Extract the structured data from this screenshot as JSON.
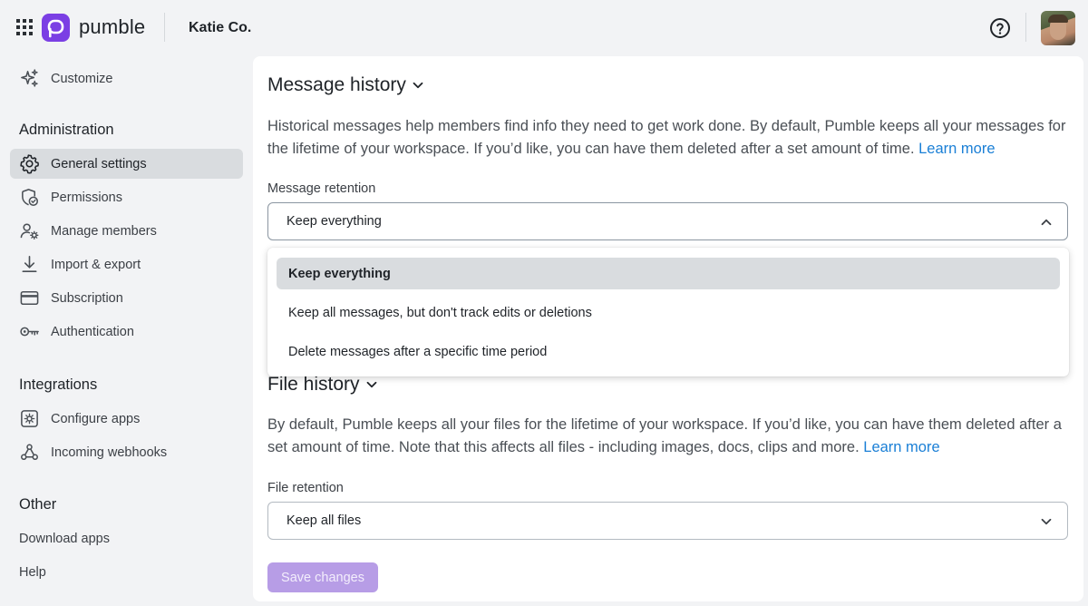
{
  "header": {
    "brand": "pumble",
    "workspace": "Katie Co."
  },
  "colors": {
    "brand": "#7b3fe4",
    "link": "#1a7fd6",
    "active_bg": "#d9dcdf",
    "save_button": "#b79de6"
  },
  "sidebar": {
    "customize": "Customize",
    "admin_heading": "Administration",
    "admin_items": [
      {
        "label": "General settings",
        "icon": "gear-icon",
        "active": true
      },
      {
        "label": "Permissions",
        "icon": "permissions-icon"
      },
      {
        "label": "Manage members",
        "icon": "manage-members-icon"
      },
      {
        "label": "Import & export",
        "icon": "download-icon"
      },
      {
        "label": "Subscription",
        "icon": "credit-card-icon"
      },
      {
        "label": "Authentication",
        "icon": "key-icon"
      }
    ],
    "integrations_heading": "Integrations",
    "integration_items": [
      {
        "label": "Configure apps",
        "icon": "configure-apps-icon"
      },
      {
        "label": "Incoming webhooks",
        "icon": "webhooks-icon"
      }
    ],
    "other_heading": "Other",
    "other_items": [
      {
        "label": "Download apps"
      },
      {
        "label": "Help"
      }
    ]
  },
  "message_history": {
    "title": "Message history",
    "description": "Historical messages help members find info they need to get work done. By default, Pumble keeps all your messages for the lifetime of your workspace. If you’d like, you can have them deleted after a set amount of time.",
    "learn_more": "Learn more",
    "retention_label": "Message retention",
    "retention_value": "Keep everything",
    "options": [
      "Keep everything",
      "Keep all messages, but don't track edits or deletions",
      "Delete messages after a specific time period"
    ]
  },
  "file_history": {
    "title": "File history",
    "description": "By default, Pumble keeps all your files for the lifetime of your workspace. If you’d like, you can have them deleted after a set amount of time. Note that this affects all files - including images, docs, clips and more.",
    "learn_more": "Learn more",
    "retention_label": "File retention",
    "retention_value": "Keep all files"
  },
  "save_label": "Save changes"
}
